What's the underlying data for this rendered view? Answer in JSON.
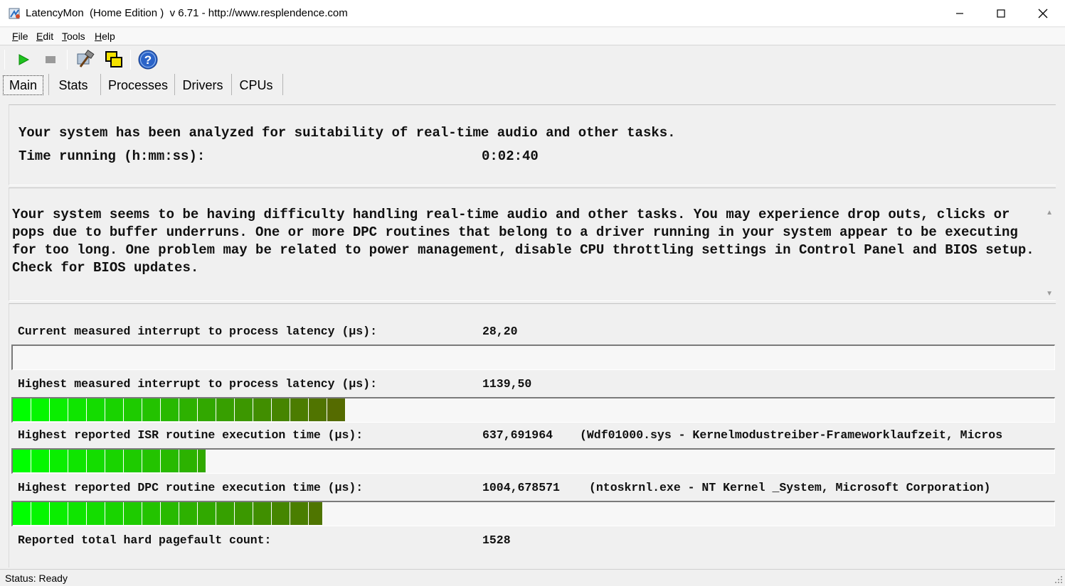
{
  "window": {
    "title": "LatencyMon  (Home Edition )  v 6.71 - http://www.resplendence.com",
    "accent": "#2b8ad6"
  },
  "menu": [
    {
      "label": "File",
      "mnemonic": "F"
    },
    {
      "label": "Edit",
      "mnemonic": "E"
    },
    {
      "label": "Tools",
      "mnemonic": "T"
    },
    {
      "label": "Help",
      "mnemonic": "H"
    }
  ],
  "toolbar": {
    "start_icon": "play-icon",
    "stop_icon": "stop-icon",
    "driver_icon": "hammer-icon",
    "window_icon": "windows-icon",
    "help_icon": "help-icon"
  },
  "tabs": [
    "Main",
    "Stats",
    "Processes",
    "Drivers",
    "CPUs"
  ],
  "active_tab": "Main",
  "summary": {
    "analyzed_text": "Your system has been analyzed for suitability of real-time audio and other tasks.",
    "time_label": "Time running (h:mm:ss):",
    "time_value": "0:02:40"
  },
  "message": "Your system seems to be having difficulty handling real-time audio and other tasks. You may experience drop outs, clicks or pops due to buffer underruns. One or more DPC routines that belong to a driver running in your system appear to be executing for too long. One problem may be related to power management, disable CPU throttling settings in Control Panel and BIOS setup. Check for BIOS updates.",
  "metrics": {
    "current_latency": {
      "label": "Current measured interrupt to process latency (µs):",
      "value": "28,20",
      "level": 0.0
    },
    "highest_latency": {
      "label": "Highest measured interrupt to process latency (µs):",
      "value": "1139,50",
      "level": 0.32
    },
    "highest_isr": {
      "label": "Highest reported ISR routine execution time (µs):",
      "value": "637,691964",
      "extra": "(Wdf01000.sys - Kernelmodustreiber-Frameworklaufzeit, Micros",
      "level": 0.186
    },
    "highest_dpc": {
      "label": "Highest reported DPC routine execution time (µs):",
      "value": "1004,678571",
      "extra": "(ntoskrnl.exe - NT Kernel _System, Microsoft Corporation)",
      "level": 0.298
    },
    "pagefault": {
      "label": "Reported total hard pagefault count:",
      "value": "1528"
    }
  },
  "colors": {
    "bar_start": "#00ff00",
    "bar_end": "#556b00"
  },
  "status": {
    "text": "Status: Ready"
  }
}
